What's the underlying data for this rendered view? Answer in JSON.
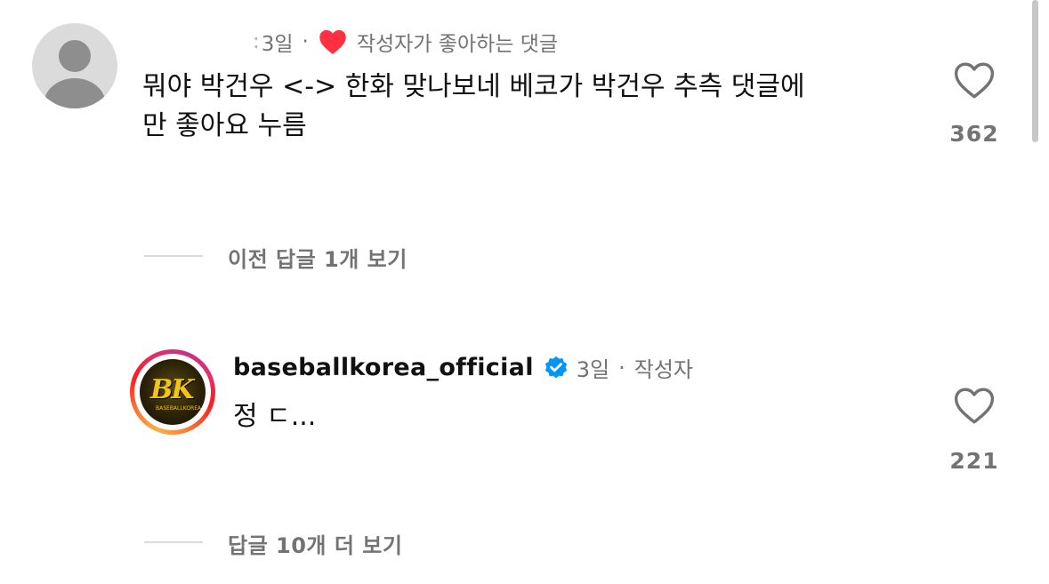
{
  "comment1": {
    "username_redacted": ":",
    "time": "3일",
    "creator_liked": "작성자가 좋아하는 댓글",
    "text_line1": "뭐야 박건우 <-> 한화 맞나보네 베코가 박건우 추측 댓글에",
    "text_line2": "만 좋아요 누름",
    "like_count": "362"
  },
  "view_previous_replies": "이전 답글 1개 보기",
  "comment2": {
    "username": "baseballkorea_official",
    "avatar_text": "BK",
    "avatar_subtext": "BASEBALLKOREA",
    "time": "3일",
    "author_label": "작성자",
    "text": "정 ㄷ...",
    "like_count": "221"
  },
  "view_more_replies": "답글 10개 더 보기",
  "icons": {
    "heart_outline": "heart-icon",
    "heart_filled": "heart-filled-icon",
    "verified": "verified-badge-icon",
    "dot": "·"
  },
  "colors": {
    "secondary_text": "#737373",
    "heart_red": "#ff3040",
    "verified_blue": "#0095f6"
  }
}
